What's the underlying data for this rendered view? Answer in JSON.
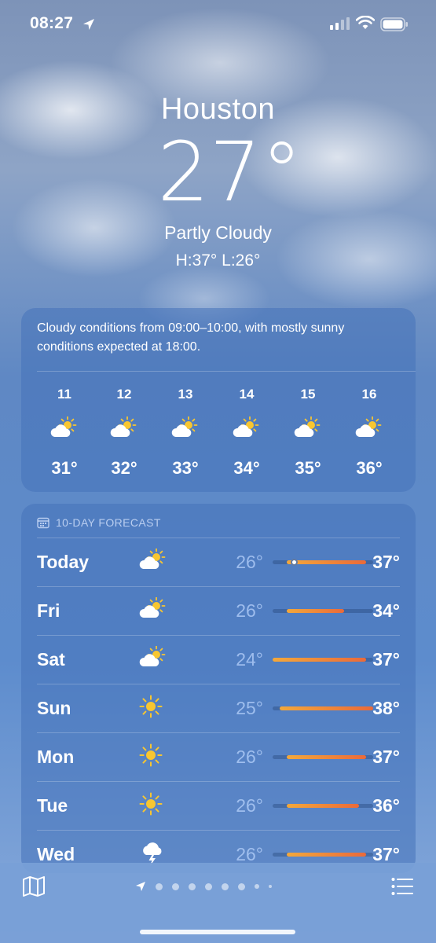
{
  "status_bar": {
    "time": "08:27"
  },
  "header": {
    "city": "Houston",
    "temperature": "27°",
    "condition": "Partly Cloudy",
    "hi_lo": "H:37°  L:26°"
  },
  "hourly": {
    "summary": "Cloudy conditions from 09:00–10:00, with mostly sunny conditions expected at 18:00.",
    "hours": [
      {
        "label": "11",
        "icon": "partly-cloudy-icon",
        "temp": "31°"
      },
      {
        "label": "12",
        "icon": "partly-cloudy-icon",
        "temp": "32°"
      },
      {
        "label": "13",
        "icon": "partly-cloudy-icon",
        "temp": "33°"
      },
      {
        "label": "14",
        "icon": "partly-cloudy-icon",
        "temp": "34°"
      },
      {
        "label": "15",
        "icon": "partly-cloudy-icon",
        "temp": "35°"
      },
      {
        "label": "16",
        "icon": "partly-cloudy-icon",
        "temp": "36°"
      }
    ]
  },
  "forecast": {
    "title": "10-DAY FORECAST",
    "days": [
      {
        "day": "Today",
        "icon": "partly-cloudy-icon",
        "low": "26°",
        "high": "37°",
        "range": [
          26,
          37
        ],
        "current": 27
      },
      {
        "day": "Fri",
        "icon": "partly-cloudy-icon",
        "low": "26°",
        "high": "34°",
        "range": [
          26,
          34
        ]
      },
      {
        "day": "Sat",
        "icon": "partly-cloudy-icon",
        "low": "24°",
        "high": "37°",
        "range": [
          24,
          37
        ]
      },
      {
        "day": "Sun",
        "icon": "sun-icon",
        "low": "25°",
        "high": "38°",
        "range": [
          25,
          38
        ]
      },
      {
        "day": "Mon",
        "icon": "sun-icon",
        "low": "26°",
        "high": "37°",
        "range": [
          26,
          37
        ]
      },
      {
        "day": "Tue",
        "icon": "sun-icon",
        "low": "26°",
        "high": "36°",
        "range": [
          26,
          36
        ]
      },
      {
        "day": "Wed",
        "icon": "thunderstorm-icon",
        "low": "26°",
        "high": "37°",
        "range": [
          26,
          37
        ]
      }
    ],
    "scale": [
      24,
      38
    ]
  },
  "bottom_bar": {
    "page_count": 9,
    "active_page": 0
  },
  "colors": {
    "bar_start": "#f3a83b",
    "bar_end": "#ea6a3a",
    "sun": "#f8c630"
  }
}
